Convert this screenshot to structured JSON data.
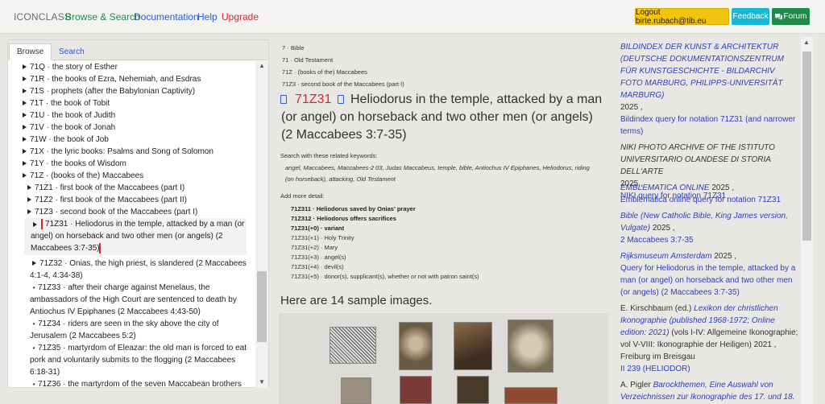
{
  "header": {
    "brand": "ICONCLASS",
    "nav": [
      {
        "label": "Browse & Search",
        "color": "#1e8a4a"
      },
      {
        "label": "Documentation",
        "color": "#2b5bd7"
      },
      {
        "label": "Help",
        "color": "#2b5bd7"
      },
      {
        "label": "Upgrade",
        "color": "#d62828"
      }
    ],
    "logout_label": "Logout birte.rubach@tib.eu",
    "feedback_label": "Feedback",
    "forum_label": "Forum"
  },
  "left": {
    "tabs": [
      "Browse",
      "Search"
    ],
    "tree": [
      "71Q · the story of Esther",
      "71R · the books of Ezra, Nehemiah, and Esdras",
      "71S · prophets (after the Babylonian Captivity)",
      "71T · the book of Tobit",
      "71U · the book of Judith",
      "71V · the book of Jonah",
      "71W · the book of Job",
      "71X · the lyric books: Psalms and Song of Solomon",
      "71Y · the books of Wisdom",
      "71Z · (books of the) Maccabees",
      "71Z1 · first book of the Maccabees (part I)",
      "71Z2 · first book of the Maccabees (part II)",
      "71Z3 · second book of the Maccabees (part I)"
    ],
    "selected": [
      "71Z31 · Heliodorus in the temple, attacked by a man (or",
      "angel) on horseback and two other men (or angels) (2",
      "Maccabees 3:7-35)"
    ],
    "children": [
      [
        "71Z32 · Onias, the high priest, is slandered (2 Maccabees",
        "4:1-4, 4:34-38)"
      ],
      [
        "71Z33 · after their charge against Menelaus, the",
        "ambassadors of the High Court are sentenced to death by",
        "Antiochus IV Epiphanes (2 Maccabees 4:43-50)"
      ],
      [
        "71Z34 · riders are seen in the sky above the city of",
        "Jerusalem (2 Maccabees 5:2)"
      ],
      [
        "71Z35 · martyrdom of Eleazar: the old man is forced to eat",
        "pork and voluntarily submits to the flogging (2 Maccabees",
        "6:18-31)"
      ],
      [
        "71Z36 · the martyrdom of the seven Maccabean brothers"
      ]
    ]
  },
  "middle": {
    "breadcrumbs": [
      "7 · Bible",
      "71 · Old Testament",
      "71Z · (books of the) Maccabees",
      "71Z3 · second book of the Maccabees (part I)"
    ],
    "notation": "71Z31",
    "headline": "Heliodorus in the temple, attacked by a man (or angel) on horseback and two other men (or angels) (2 Maccabees 3:7-35)",
    "keywords_label": "Search with these related keywords:",
    "keywords": "angel, Maccabees, Maccabees-2 03, Judas Maccabeus, temple, bible, Antiochus IV Epiphanes, Heliodorus, riding (on horseback), attacking, Old Testament",
    "detail_label": "Add more detail:",
    "details_bold": [
      "71Z311 · Heliodorus saved by Onias' prayer",
      "71Z312 · Heliodorus offers sacrifices",
      "71Z31(+0) · variant"
    ],
    "details": [
      "71Z31(+1) · Holy Trinity",
      "71Z31(+2) · Mary",
      "71Z31(+3) · angel(s)",
      "71Z31(+4) · devil(s)",
      "71Z31(+5) · donor(s), supplicant(s), whether or not with patron saint(s)"
    ],
    "sample_heading": "Here are 14 sample images."
  },
  "right": {
    "b1_src": "BILDINDEX DER KUNST & ARCHITEKTUR (DEUTSCHE DOKUMENTATIONSZENTRUM FÜR KUNSTGESCHICHTE - BILDARCHIV FOTO MARBURG, PHILIPPS-UNIVERSITÄT MARBURG)",
    "b1_year": "2025 ,",
    "b1_link": "Bildindex query for notation 71Z31 (and narrower terms)",
    "b2_src": "NIKI PHOTO ARCHIVE OF THE ISTITUTO UNIVERSITARIO OLANDESE DI STORIA DELL'ARTE",
    "b2_year": "2025 ,",
    "b2_link": "NIKI query for notation 71Z31",
    "b3_src": "EMBLEMATICA ONLINE",
    "b3_year": "2025 ,",
    "b3_link": "Emblematica online query for notation 71Z31",
    "b4_src": "Bible (New Catholic Bible, King James version, Vulgate)",
    "b4_year": "2025 ,",
    "b4_link": "2 Maccabees 3:7-35",
    "b5_src": "Rijksmuseum Amsterdam",
    "b5_year": "2025 ,",
    "b5_link": "Query for Heliodorus in the temple, attacked by a man (or angel) on horseback and two other men (or angels) (2 Maccabees 3:7-35)",
    "b6_pre": "E. Kirschbaum (ed.)",
    "b6_src": "Lexikon der christlichen Ikonographie (published 1968-1972; Online edition: 2021)",
    "b6_rest": "(vols I-IV: Allgemeine Ikonographie; vol V-VIII: Ikonographie der Heiligen) 2021 , Freiburg im Breisgau",
    "b6_link": "II 239 (HELIODOR)",
    "b7_pre": "A. Pigler",
    "b7_src": "Barockthemen, Eine Auswahl von Verzeichnissen zur Ikonographie des 17. und 18."
  }
}
